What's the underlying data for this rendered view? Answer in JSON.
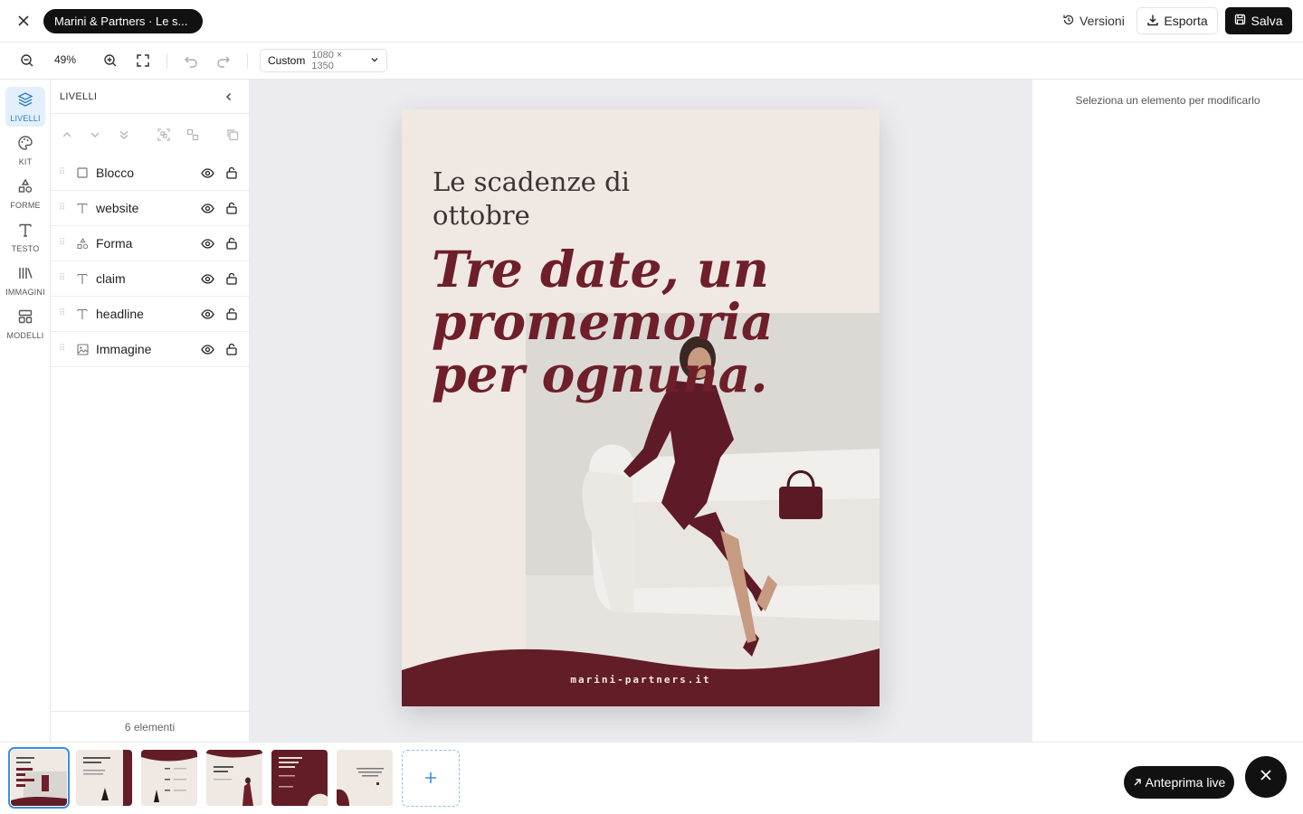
{
  "topbar": {
    "document_title": "Marini & Partners · Le s...",
    "versions_label": "Versioni",
    "export_label": "Esporta",
    "save_label": "Salva"
  },
  "toolbar": {
    "zoom": "49%",
    "size_preset": "Custom",
    "size_dims": "1080 × 1350"
  },
  "rail": {
    "items": [
      {
        "label": "LIVELLI",
        "icon": "layers-icon",
        "active": true
      },
      {
        "label": "KIT",
        "icon": "palette-icon",
        "active": false
      },
      {
        "label": "FORME",
        "icon": "shapes-icon",
        "active": false
      },
      {
        "label": "TESTO",
        "icon": "text-icon",
        "active": false
      },
      {
        "label": "IMMAGINI",
        "icon": "library-icon",
        "active": false
      },
      {
        "label": "MODELLI",
        "icon": "templates-icon",
        "active": false
      }
    ]
  },
  "layers": {
    "title": "LIVELLI",
    "items": [
      {
        "name": "Blocco",
        "type": "square-icon"
      },
      {
        "name": "website",
        "type": "text-icon"
      },
      {
        "name": "Forma",
        "type": "shapes-icon"
      },
      {
        "name": "claim",
        "type": "text-icon"
      },
      {
        "name": "headline",
        "type": "text-icon"
      },
      {
        "name": "Immagine",
        "type": "image-icon"
      }
    ],
    "count_label": "6 elementi"
  },
  "artboard": {
    "headline": "Le scadenze di ottobre",
    "claim": "Tre date, un promemoria per ognuna.",
    "website": "marini-partners.it",
    "colors": {
      "background": "#efe8e3",
      "accent": "#6e1f29",
      "footer": "#631d27"
    }
  },
  "props": {
    "hint": "Seleziona un elemento per modificarlo"
  },
  "pages": {
    "count": 6,
    "active_index": 0,
    "preview_label": "Anteprima live"
  }
}
